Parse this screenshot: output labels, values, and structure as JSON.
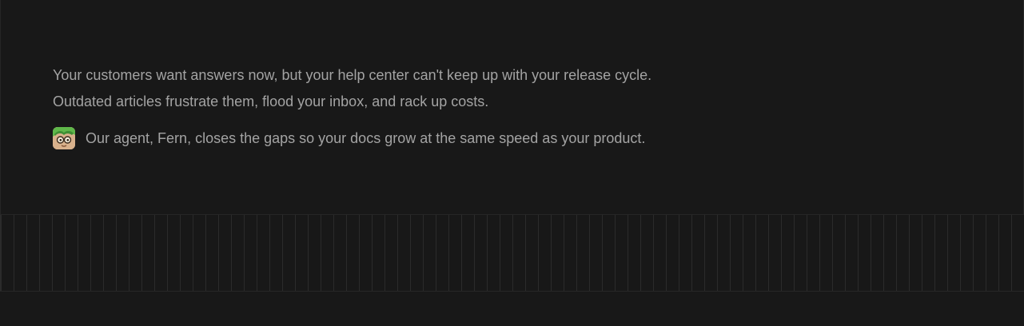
{
  "intro": {
    "line1": "Your customers want answers now, but your help center can't keep up with your release cycle.",
    "line2": "Outdated articles frustrate them, flood your inbox, and rack up costs.",
    "agent_line": "Our agent, Fern, closes the gaps so your docs grow at the same speed as your product.",
    "avatar_icon": "fern-avatar-icon"
  },
  "colors": {
    "background": "#181818",
    "text": "#a3a3a3",
    "border": "#262626",
    "stripe": "#2b2b2b",
    "avatar_hair": "#5fb84a"
  }
}
